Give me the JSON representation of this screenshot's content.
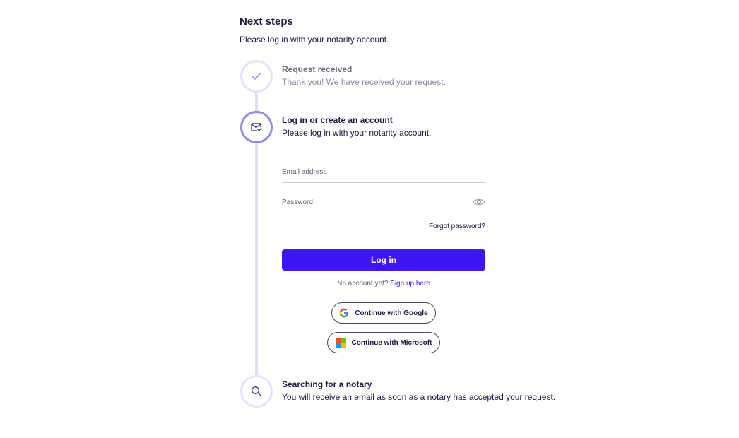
{
  "header": {
    "title": "Next steps",
    "subtitle": "Please log in with your notarity account."
  },
  "steps": [
    {
      "title": "Request received",
      "description": "Thank you! We have received your request.",
      "status": "done",
      "icon": "check-icon"
    },
    {
      "title": "Log in or create an account",
      "description": "Please log in with your notarity account.",
      "status": "active",
      "icon": "mail-check-icon"
    },
    {
      "title": "Searching for a notary",
      "description": "You will receive an email as soon as a notary has accepted your request.",
      "status": "pending",
      "icon": "search-icon"
    }
  ],
  "login_form": {
    "email_placeholder": "Email address",
    "email_value": "",
    "password_placeholder": "Password",
    "password_value": "",
    "forgot_password": "Forgot password?",
    "login_button": "Log in",
    "no_account_text": "No account yet?",
    "signup_link": "Sign up here",
    "google_button": "Continue with Google",
    "microsoft_button": "Continue with Microsoft"
  },
  "colors": {
    "primary": "#3d16f3",
    "text": "#1a1740",
    "timeline": "#dcdcfb",
    "active_ring": "#8f8cf0"
  }
}
